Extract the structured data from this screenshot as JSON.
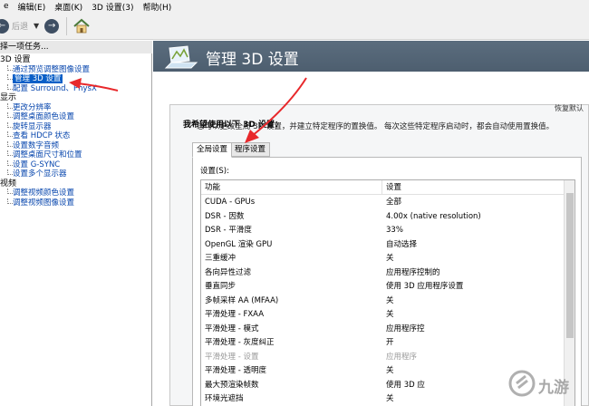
{
  "menu": {
    "items": [
      "e",
      "编辑(E)",
      "桌面(K)",
      "3D 设置(3)",
      "帮助(H)"
    ]
  },
  "toolbar": {
    "back_label": "后退",
    "back_icon": "back-arrow-icon",
    "forward_icon": "forward-arrow-icon",
    "home_icon": "home-icon"
  },
  "sidebar": {
    "task_header": "择一项任务...",
    "groups": [
      {
        "label": "3D 设置",
        "items": [
          "通过预览调整图像设置",
          "管理 3D 设置",
          "配置 Surround、PhysX"
        ]
      },
      {
        "label": "显示",
        "items": [
          "更改分辨率",
          "调整桌面颜色设置",
          "旋转显示器",
          "查看 HDCP 状态",
          "设置数字音频",
          "调整桌面尺寸和位置",
          "设置 G-SYNC",
          "设置多个显示器"
        ]
      },
      {
        "label": "视频",
        "items": [
          "调整视频颜色设置",
          "调整视频图像设置"
        ]
      }
    ],
    "selected": "管理 3D 设置"
  },
  "main": {
    "title": "管理 3D 设置",
    "restore_label": "恢复默认",
    "description": "您可以更改全局 3D 设置，并建立特定程序的置换值。 每次这些特定程序启动时，都会自动使用置换值。",
    "panel_title": "我希望使用以下 3D 设置：",
    "tabs": [
      "全局设置",
      "程序设置"
    ],
    "active_tab": "全局设置",
    "settings_label": "设置(S):",
    "table": {
      "headers": [
        "功能",
        "设置"
      ],
      "rows": [
        {
          "feature": "CUDA - GPUs",
          "setting": "全部",
          "enabled": true
        },
        {
          "feature": "DSR - 因数",
          "setting": "4.00x (native resolution)",
          "enabled": true
        },
        {
          "feature": "DSR - 平滑度",
          "setting": "33%",
          "enabled": true
        },
        {
          "feature": "OpenGL 渲染 GPU",
          "setting": "自动选择",
          "enabled": true
        },
        {
          "feature": "三重缓冲",
          "setting": "关",
          "enabled": true
        },
        {
          "feature": "各向异性过滤",
          "setting": "应用程序控制的",
          "enabled": true
        },
        {
          "feature": "垂直同步",
          "setting": "使用 3D 应用程序设置",
          "enabled": true
        },
        {
          "feature": "多帧采样 AA (MFAA)",
          "setting": "关",
          "enabled": true
        },
        {
          "feature": "平滑处理 - FXAA",
          "setting": "关",
          "enabled": true
        },
        {
          "feature": "平滑处理 - 模式",
          "setting": "应用程序控",
          "enabled": true
        },
        {
          "feature": "平滑处理 - 灰度纠正",
          "setting": "开",
          "enabled": true
        },
        {
          "feature": "平滑处理 - 设置",
          "setting": "应用程序",
          "enabled": false
        },
        {
          "feature": "平滑处理 - 透明度",
          "setting": "关",
          "enabled": true
        },
        {
          "feature": "最大预渲染帧数",
          "setting": "使用 3D 应",
          "enabled": true
        },
        {
          "feature": "环境光遮挡",
          "setting": "关",
          "enabled": true
        }
      ]
    }
  },
  "watermark": {
    "text": "九游"
  },
  "colors": {
    "banner": "#556677",
    "selection": "#0a5fc7",
    "annotation_arrow": "#e8282b",
    "link": "#0645ad"
  }
}
